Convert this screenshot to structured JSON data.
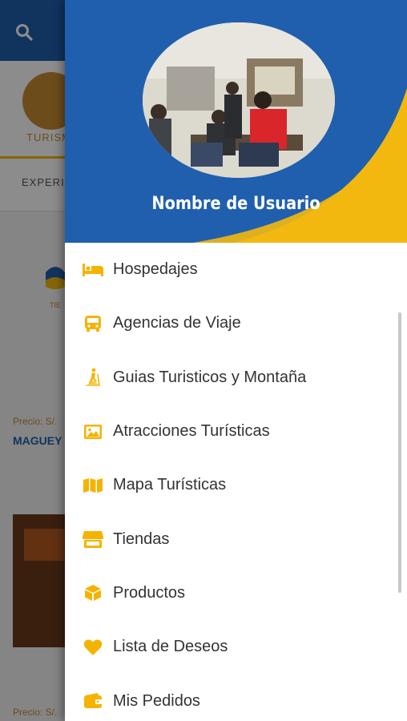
{
  "background_app": {
    "category_label": "TURISM",
    "tab_label": "EXPERIE",
    "card_logo_text": "TIE",
    "price_1": "Precio: S/.",
    "product_name_1": "MAGUEY",
    "price_2": "Precio: S/."
  },
  "drawer": {
    "user_name": "Nombre de Usuario",
    "menu_items": [
      {
        "label": "Hospedajes",
        "icon": "bed-icon"
      },
      {
        "label": "Agencias de Viaje",
        "icon": "bus-icon"
      },
      {
        "label": "Guias Turisticos y Montaña",
        "icon": "hiker-icon"
      },
      {
        "label": "Atracciones Turísticas",
        "icon": "image-icon"
      },
      {
        "label": "Mapa Turísticas",
        "icon": "map-icon"
      },
      {
        "label": "Tiendas",
        "icon": "store-icon"
      },
      {
        "label": "Productos",
        "icon": "box-icon"
      },
      {
        "label": "Lista de Deseos",
        "icon": "heart-icon"
      },
      {
        "label": "Mis Pedidos",
        "icon": "wallet-icon"
      }
    ]
  },
  "colors": {
    "primary_blue": "#1f5fae",
    "accent_yellow": "#f3b810",
    "icon_yellow": "#f5b301"
  }
}
